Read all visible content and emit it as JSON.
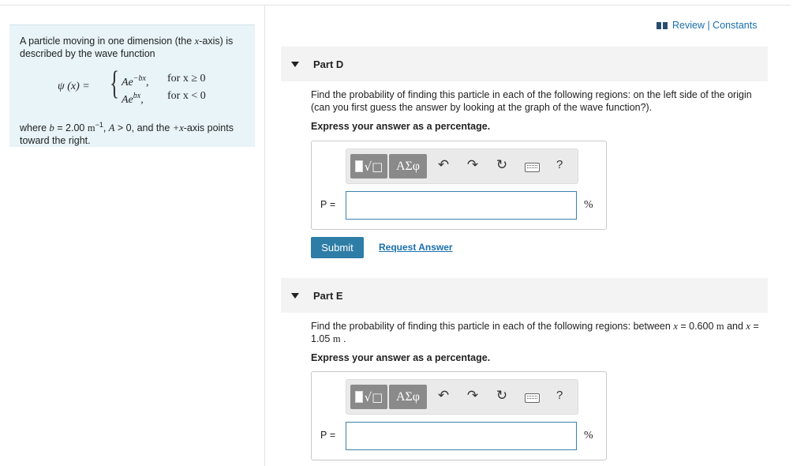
{
  "problem": {
    "intro": "A particle moving in one dimension (the x-axis) is described by the wave function",
    "intro_parts": [
      "A particle moving in one dimension (the ",
      "x",
      "-axis) is described by the wave function"
    ],
    "equation": {
      "lhs": "ψ (x) =",
      "row1_expr": "Ae",
      "row1_exp": "−bx",
      "row1_cond": "for x ≥ 0",
      "row2_expr": "Ae",
      "row2_exp": "bx",
      "row2_cond": "for x < 0"
    },
    "where_parts": [
      "where ",
      "b",
      " = 2.00 ",
      "m",
      "−1",
      ", ",
      "A",
      " > 0, and the ",
      "+x",
      "-axis points toward the right."
    ]
  },
  "header": {
    "review_label": "Review | Constants"
  },
  "parts": [
    {
      "title": "Part D",
      "question": "Find the probability of finding this particle in each of the following regions: on the left side of the origin (can you first guess the answer by looking at the graph of the wave function?).",
      "express": "Express your answer as a percentage.",
      "var_label": "P",
      "eq_sign": "=",
      "unit": "%",
      "value": ""
    },
    {
      "title": "Part E",
      "question_parts": [
        "Find the probability of finding this particle in each of the following regions: between ",
        "x",
        " = 0.600 ",
        "m",
        " and ",
        "x",
        " = 1.05 ",
        "m",
        " ."
      ],
      "express": "Express your answer as a percentage.",
      "var_label": "P",
      "eq_sign": "=",
      "unit": "%",
      "value": ""
    }
  ],
  "toolbar": {
    "template_icon": "template-sqrt-icon",
    "symbols_label": "ΑΣφ",
    "undo_icon": "undo-icon",
    "redo_icon": "redo-icon",
    "reset_icon": "reset-icon",
    "keyboard_icon": "keyboard-icon",
    "help_label": "?"
  },
  "actions": {
    "submit_label": "Submit",
    "request_label": "Request Answer"
  }
}
